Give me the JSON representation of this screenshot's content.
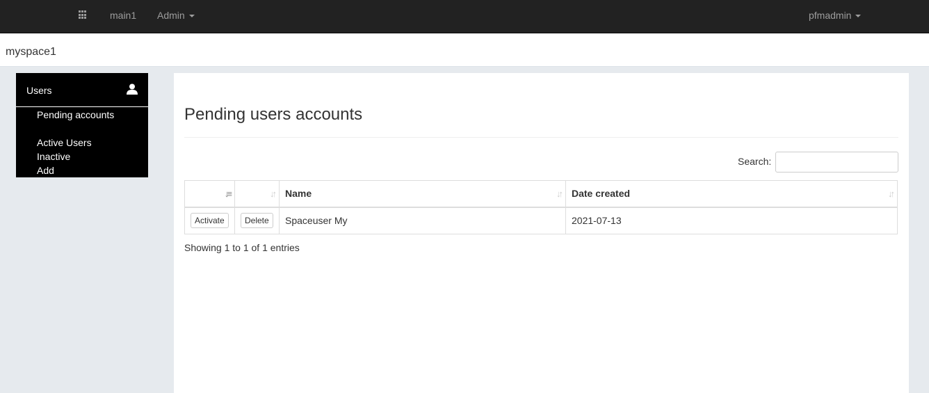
{
  "navbar": {
    "apps_icon": "grid-icon",
    "items": [
      {
        "label": "main1"
      },
      {
        "label": "Admin",
        "dropdown": true
      }
    ],
    "user": {
      "label": "pfmadmin",
      "dropdown": true
    }
  },
  "space": {
    "name": "myspace1"
  },
  "sidebar": {
    "section_title": "Users",
    "section_icon": "user-icon",
    "links": [
      {
        "label": "Pending accounts"
      },
      {
        "label": "Active Users"
      },
      {
        "label": "Inactive"
      },
      {
        "label": "Add"
      }
    ]
  },
  "main": {
    "title": "Pending users accounts",
    "search": {
      "label": "Search:",
      "value": "",
      "placeholder": ""
    },
    "table": {
      "columns": [
        {
          "label": "",
          "sort": "ascending"
        },
        {
          "label": "",
          "sort": "none"
        },
        {
          "label": "Name",
          "sort": "none"
        },
        {
          "label": "Date created",
          "sort": "none"
        }
      ],
      "rows": [
        {
          "activate_label": "Activate",
          "delete_label": "Delete",
          "name": "Spaceuser My",
          "date_created": "2021-07-13"
        }
      ]
    },
    "info": "Showing 1 to 1 of 1 entries"
  }
}
